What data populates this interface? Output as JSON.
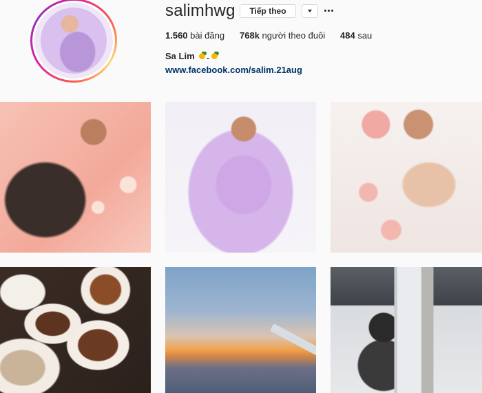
{
  "profile": {
    "username": "salimhwg",
    "follow_label": "Tiếp theo",
    "full_name": "Sa Lim",
    "link": "www.facebook.com/salim.21aug",
    "emoji_icon": "pineapple-emoji"
  },
  "stats": {
    "posts_value": "1.560",
    "posts_label": "bài đăng",
    "followers_value": "768k",
    "followers_label": "người theo đuôi",
    "following_value": "484",
    "following_label": "sau"
  },
  "icons": {
    "dropdown": "chevron-down-icon",
    "more": "more-options-icon"
  },
  "posts": [
    {
      "name": "pink-milk-bath"
    },
    {
      "name": "lavender-milk-bath"
    },
    {
      "name": "flower-milk-bath"
    },
    {
      "name": "food-dishes"
    },
    {
      "name": "sunset-sky-wing"
    },
    {
      "name": "mirror-selfie"
    }
  ]
}
